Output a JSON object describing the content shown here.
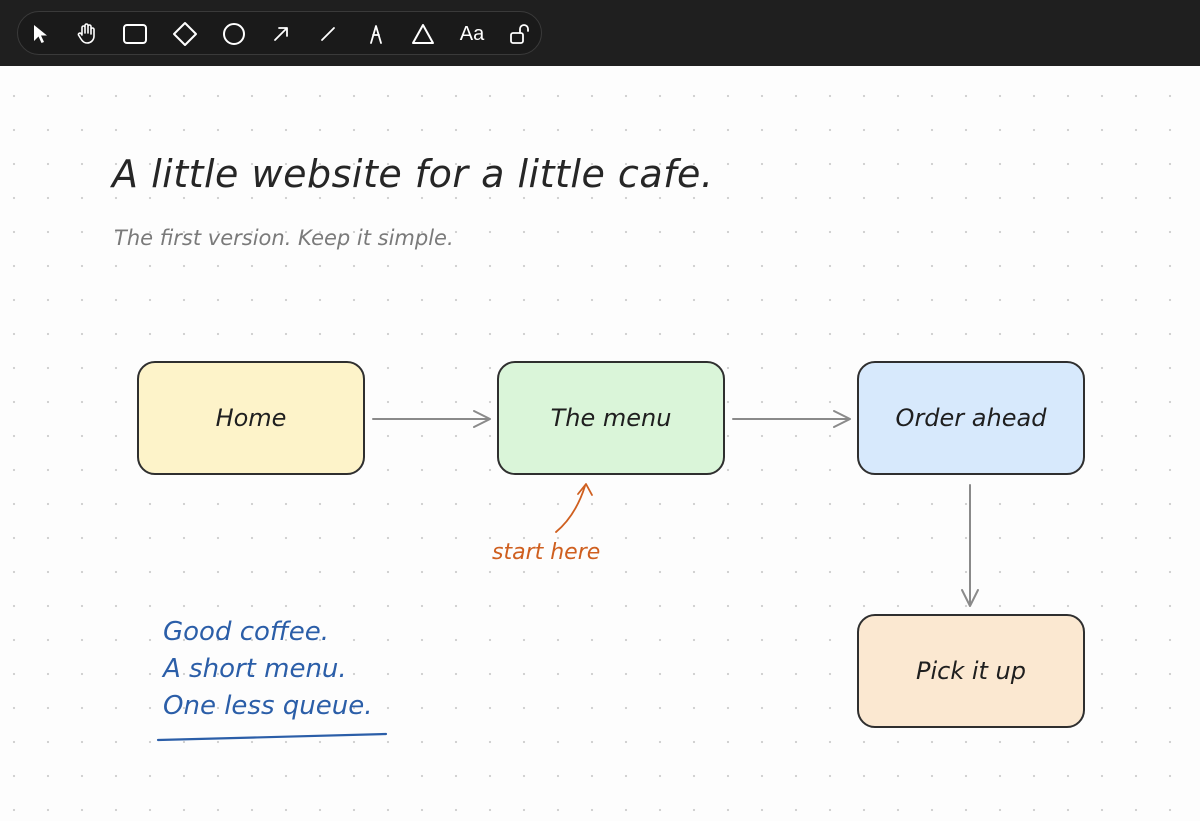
{
  "toolbar": {
    "tools": [
      {
        "name": "select",
        "icon": "pointer-icon"
      },
      {
        "name": "hand",
        "icon": "hand-icon"
      },
      {
        "name": "rectangle",
        "icon": "rectangle-icon"
      },
      {
        "name": "diamond",
        "icon": "diamond-icon"
      },
      {
        "name": "ellipse",
        "icon": "circle-icon"
      },
      {
        "name": "arrow",
        "icon": "arrow-icon"
      },
      {
        "name": "line",
        "icon": "line-icon"
      },
      {
        "name": "draw",
        "icon": "pen-icon"
      },
      {
        "name": "triangle",
        "icon": "triangle-icon"
      },
      {
        "name": "text",
        "icon": "text-icon",
        "label": "Aa"
      },
      {
        "name": "lock",
        "icon": "unlock-icon"
      }
    ]
  },
  "canvas": {
    "title": "A little website for a little cafe.",
    "subtitle": "The first version. Keep it simple.",
    "nodes": {
      "home": "Home",
      "menu": "The menu",
      "order": "Order ahead",
      "pickup": "Pick it up"
    },
    "colors": {
      "home_fill": "#fdf3c9",
      "menu_fill": "#daf5d9",
      "order_fill": "#d7e9fc",
      "pickup_fill": "#fbe8d1",
      "connector": "#8a8a8a",
      "annotation": "#cf5f1f",
      "notes": "#2b5ea8"
    },
    "annotation": "start here",
    "notes": [
      "Good coffee.",
      "A short menu.",
      "One less queue."
    ]
  }
}
